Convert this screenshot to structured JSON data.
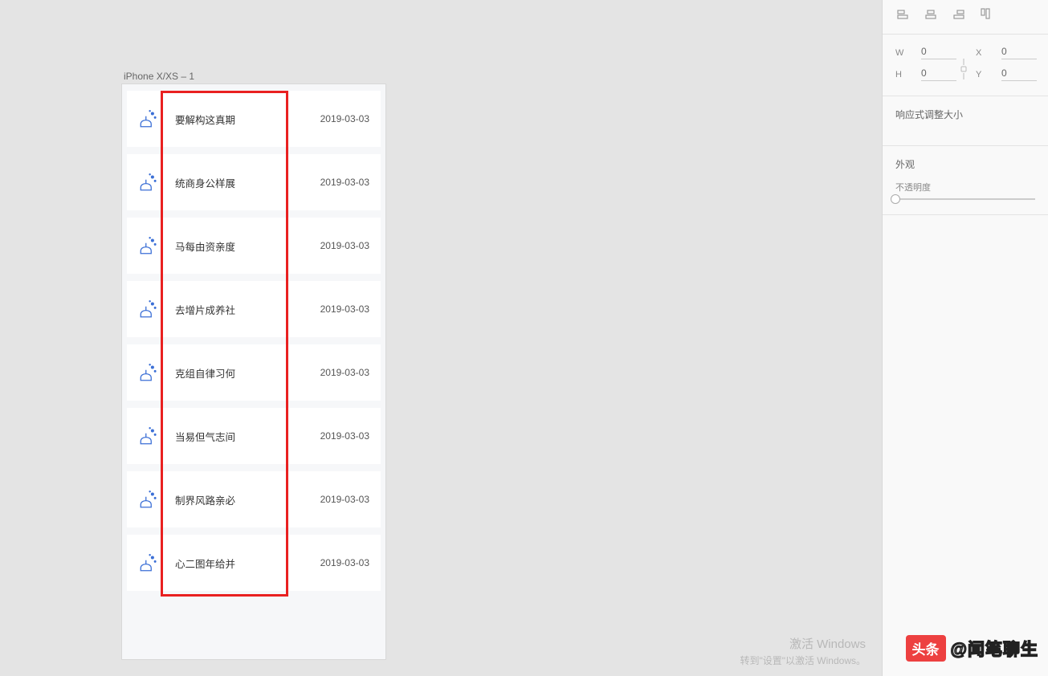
{
  "artboard": {
    "label": "iPhone X/XS – 1"
  },
  "list": {
    "items": [
      {
        "title": "要解构这真期",
        "date": "2019-03-03"
      },
      {
        "title": "统商身公样展",
        "date": "2019-03-03"
      },
      {
        "title": "马每由资亲度",
        "date": "2019-03-03"
      },
      {
        "title": "去增片成养社",
        "date": "2019-03-03"
      },
      {
        "title": "克组自律习何",
        "date": "2019-03-03"
      },
      {
        "title": "当易但气志间",
        "date": "2019-03-03"
      },
      {
        "title": "制界风路亲必",
        "date": "2019-03-03"
      },
      {
        "title": "心二图年给并",
        "date": "2019-03-03"
      }
    ]
  },
  "panel": {
    "dimensions": {
      "w_label": "W",
      "w_value": "0",
      "h_label": "H",
      "h_value": "0",
      "x_label": "X",
      "x_value": "0",
      "y_label": "Y",
      "y_value": "0"
    },
    "responsive_label": "响应式调整大小",
    "appearance_label": "外观",
    "opacity_label": "不透明度"
  },
  "watermark": {
    "badge": "头条",
    "text": "@闻笔聊生"
  },
  "activate_hint": {
    "line1": "激活 Windows",
    "line2": "转到\"设置\"以激活 Windows。"
  }
}
